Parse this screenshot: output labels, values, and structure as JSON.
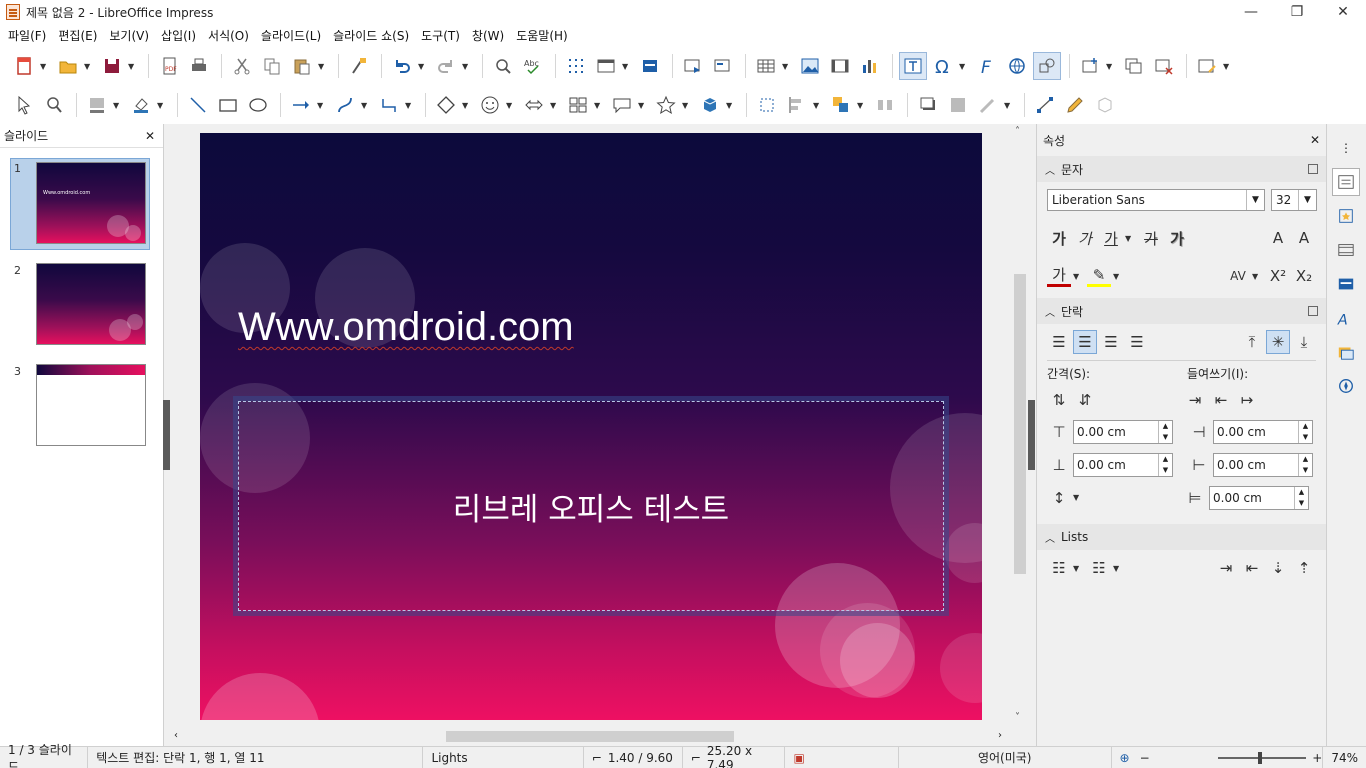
{
  "window": {
    "title": "제목 없음 2 - LibreOffice Impress",
    "minimize": "—",
    "restore": "❐",
    "close": "✕"
  },
  "menu": [
    "파일(F)",
    "편집(E)",
    "보기(V)",
    "삽입(I)",
    "서식(O)",
    "슬라이드(L)",
    "슬라이드 쇼(S)",
    "도구(T)",
    "창(W)",
    "도움말(H)"
  ],
  "slide_panel": {
    "title": "슬라이드",
    "close": "✕",
    "slides": [
      {
        "number": "1",
        "text": "Www.omdroid.com"
      },
      {
        "number": "2",
        "text": ""
      },
      {
        "number": "3",
        "text": ""
      }
    ]
  },
  "slide": {
    "title": "Www.omdroid.com",
    "body": "리브레 오피스 테스트"
  },
  "sidebar": {
    "title": "속성",
    "close": "✕",
    "character": {
      "heading": "문자",
      "font_name": "Liberation Sans",
      "font_size": "32",
      "bold": "가",
      "italic": "가",
      "underline": "가",
      "strike": "가",
      "shadow": "가",
      "font_color": "가",
      "grow": "A",
      "shrink": "A",
      "spacing": "AV",
      "superscript": "X²",
      "subscript": "X₂"
    },
    "paragraph": {
      "heading": "단락",
      "spacing_label": "간격(S):",
      "indent_label": "들여쓰기(I):",
      "above": "0.00 cm",
      "below": "0.00 cm",
      "before_text": "0.00 cm",
      "after_text": "0.00 cm",
      "first_line": "0.00 cm"
    },
    "lists": {
      "heading": "Lists"
    }
  },
  "statusbar": {
    "slide_pos": "1 / 3 슬라이드",
    "mode": "텍스트 편집: 단락 1, 행 1, 열 11",
    "master": "Lights",
    "position": "1.40 / 9.60",
    "size": "25.20 x 7.49",
    "language": "영어(미국)",
    "zoom": "74%",
    "zoom_minus": "−",
    "zoom_plus": "+"
  }
}
